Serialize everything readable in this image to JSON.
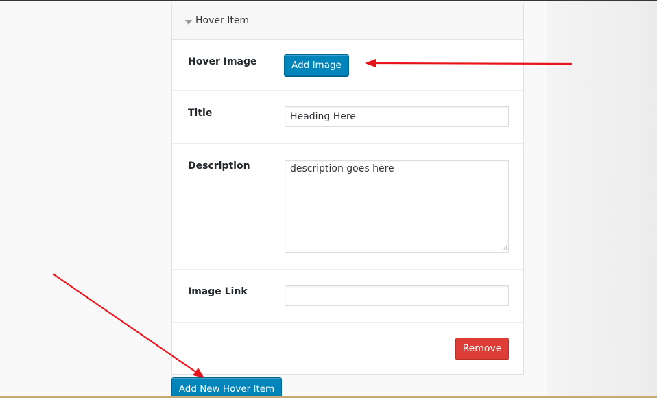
{
  "panel": {
    "title": "Hover Item",
    "fields": {
      "hover_image_label": "Hover Image",
      "add_image_button": "Add Image",
      "title_label": "Title",
      "title_value": "Heading Here",
      "description_label": "Description",
      "description_value": "description goes here",
      "image_link_label": "Image Link",
      "image_link_value": ""
    },
    "remove_button": "Remove"
  },
  "add_new_button": "Add New Hover Item",
  "colors": {
    "primary_button": "#0085ba",
    "danger_button": "#dd3d36",
    "annotation_arrow": "#e8141b"
  },
  "annotations": {
    "arrow_icon": "red-arrow-icon"
  }
}
